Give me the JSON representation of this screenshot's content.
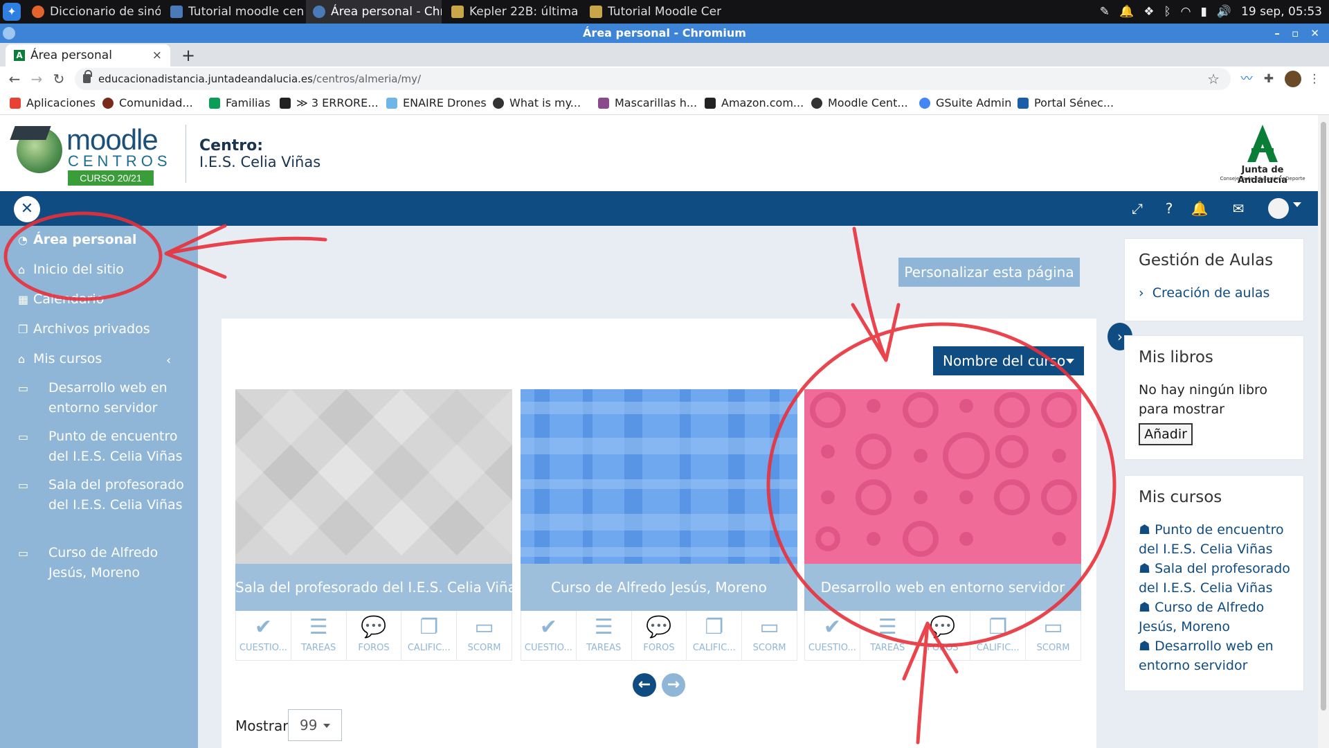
{
  "system": {
    "tasks": [
      {
        "label": "Diccionario de sinó...",
        "color": "#e2632b"
      },
      {
        "label": "Tutorial moodle cen...",
        "color": "#4a7ab8"
      },
      {
        "label": "Área personal - Chro...",
        "color": "#4a7ab8"
      },
      {
        "label": "Kepler 22B: última it...",
        "color": "#c9a64a"
      },
      {
        "label": "Tutorial Moodle Cen...",
        "color": "#c9a64a"
      }
    ],
    "clock": "19 sep, 05:53"
  },
  "window": {
    "title": "Área personal - Chromium"
  },
  "browser": {
    "tab_title": "Área personal",
    "tab_favicon": "A",
    "url_host": "educacionadistancia.juntadeandalucia.es",
    "url_path": "/centros/almeria/my/",
    "bookmarks": [
      {
        "label": "Aplicaciones",
        "color": "#e94235"
      },
      {
        "label": "Comunidad...",
        "color": "#7a2a1a"
      },
      {
        "label": "Familias",
        "color": "#0a9d58"
      },
      {
        "label": "≫ 3 ERRORE...",
        "color": "#222222"
      },
      {
        "label": "ENAIRE Drones",
        "color": "#6fb6e8"
      },
      {
        "label": "What is my...",
        "color": "#333333"
      },
      {
        "label": "Mascarillas h...",
        "color": "#8b4a8b"
      },
      {
        "label": "Amazon.com...",
        "color": "#222222"
      },
      {
        "label": "Moodle Cent...",
        "color": "#333333"
      },
      {
        "label": "GSuite Admin",
        "color": "#4285f4"
      },
      {
        "label": "Portal Sénec...",
        "color": "#1a5ea8"
      }
    ]
  },
  "header": {
    "logo_moodle": "moodle",
    "logo_centros": "CENTROS",
    "logo_curso": "CURSO 20/21",
    "centro_label": "Centro:",
    "centro_name": "I.E.S. Celia Viñas",
    "junta_name": "Junta de Andalucía",
    "junta_sub": "Consejería de Educación y Deporte"
  },
  "sidebar": {
    "items": [
      {
        "label": "Área personal",
        "icon": "dashboard-icon"
      },
      {
        "label": "Inicio del sitio",
        "icon": "home-icon"
      },
      {
        "label": "Calendario",
        "icon": "calendar-icon"
      },
      {
        "label": "Archivos privados",
        "icon": "file-icon"
      },
      {
        "label": "Mis cursos",
        "icon": "graduation-cap-icon"
      }
    ],
    "courses": [
      "Desarrollo web en entorno servidor",
      "Punto de encuentro del I.E.S. Celia Viñas",
      "Sala del profesorado del I.E.S. Celia Viñas",
      "Curso de Alfredo Jesús, Moreno"
    ]
  },
  "main": {
    "customize_button": "Personalizar esta página",
    "sort_button": "Nombre del curso",
    "courses": [
      {
        "title": "Sala del profesorado del I.E.S. Celia Viñas"
      },
      {
        "title": "Curso de Alfredo Jesús, Moreno"
      },
      {
        "title": "Desarrollo web en entorno servidor"
      }
    ],
    "activities": [
      "CUESTIO...",
      "TAREAS",
      "FOROS",
      "CALIFIC...",
      "SCORM"
    ],
    "show_label": "Mostrar",
    "show_value": "99"
  },
  "blocks": {
    "gestion": {
      "title": "Gestión de Aulas",
      "link": "Creación de aulas"
    },
    "libros": {
      "title": "Mis libros",
      "text": "No hay ningún libro para mostrar",
      "button": "Añadir"
    },
    "mis_cursos": {
      "title": "Mis cursos",
      "links": [
        "Punto de encuentro del I.E.S. Celia Viñas",
        "Sala del profesorado del I.E.S. Celia Viñas",
        "Curso de Alfredo Jesús, Moreno",
        "Desarrollo web en entorno servidor"
      ]
    }
  },
  "colors": {
    "brand": "#0f4c81",
    "sidebar": "#8fb6d6",
    "annotation": "#e8303a"
  }
}
